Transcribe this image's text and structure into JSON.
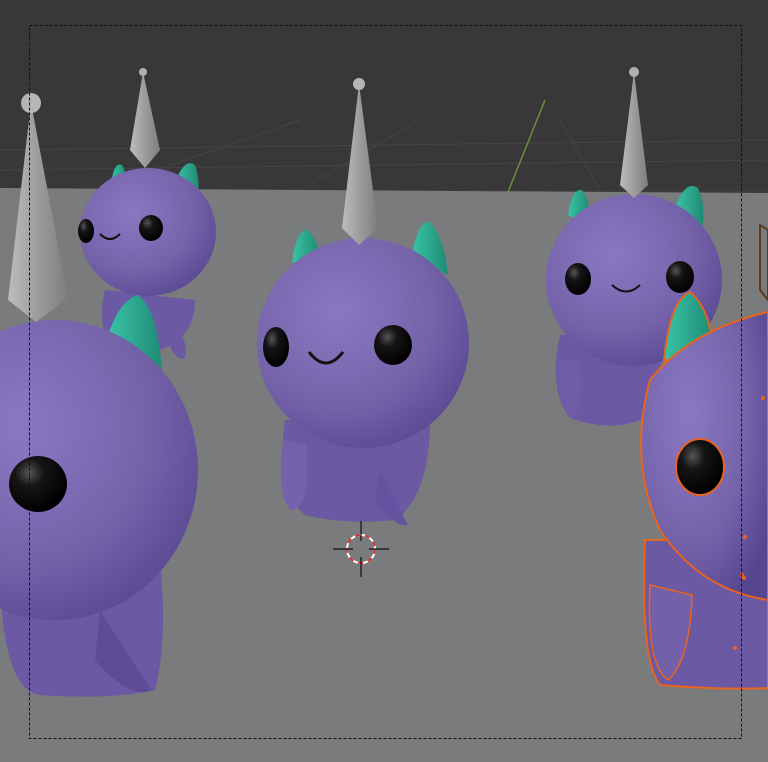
{
  "app": {
    "view_title": "",
    "view_info": ""
  },
  "scene": {
    "character_count": 5,
    "selected_character": "right-character",
    "colors": {
      "void_top": "#3b3b3b",
      "void_band": "#353535",
      "floor": "#7a7b7c",
      "body": "#7a66b0",
      "body_shade": "#5d4d92",
      "horn": "#2fae94",
      "spike": "#a8a8a8",
      "eye": "#111111",
      "selection_outline": "#e8641f",
      "camera_frame": "#101010",
      "cursor_red": "#d33333",
      "axis_green": "#6a8f3a"
    }
  },
  "icons": {
    "cursor": "3d-cursor-icon",
    "camera_frame": "camera-frame-icon"
  }
}
